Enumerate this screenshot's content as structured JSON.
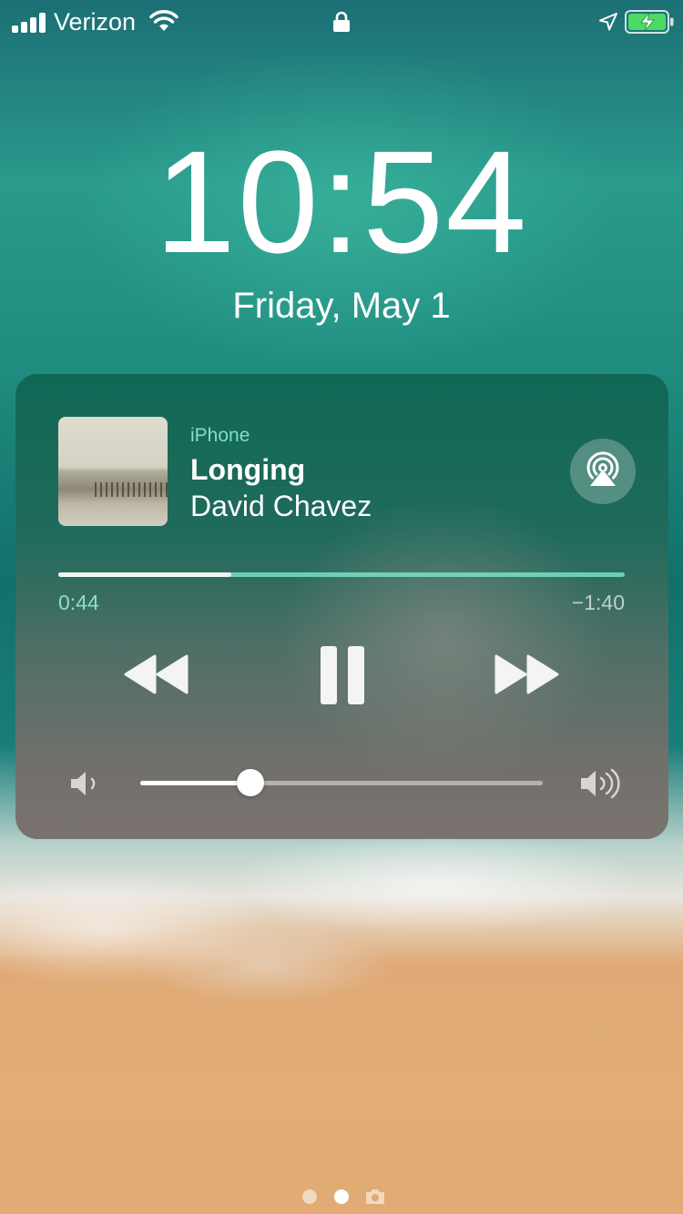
{
  "status_bar": {
    "carrier": "Verizon",
    "signal_bars": 3,
    "signal_bars_total": 4,
    "wifi_icon": "wifi-icon",
    "lock_icon": "lock-icon",
    "location_icon": "location-arrow-icon",
    "battery_icon": "battery-charging-icon",
    "battery_color": "#4cd964"
  },
  "lock_screen": {
    "time": "10:54",
    "date": "Friday, May 1"
  },
  "now_playing": {
    "output_device": "iPhone",
    "song_title": "Longing",
    "artist": "David Chavez",
    "artwork": "album-artwork-beach",
    "airplay_icon": "airplay-icon",
    "elapsed": "0:44",
    "remaining": "−1:40",
    "progress_fraction": 0.306,
    "controls": {
      "rewind_icon": "rewind-icon",
      "pause_icon": "pause-icon",
      "forward_icon": "fast-forward-icon"
    },
    "volume": {
      "low_icon": "volume-low-icon",
      "high_icon": "volume-high-icon",
      "level_fraction": 0.274
    },
    "accent_color": "#7fe0c6"
  },
  "page_indicator": {
    "page_count": 2,
    "current_page": 2,
    "camera_icon": "camera-icon"
  }
}
